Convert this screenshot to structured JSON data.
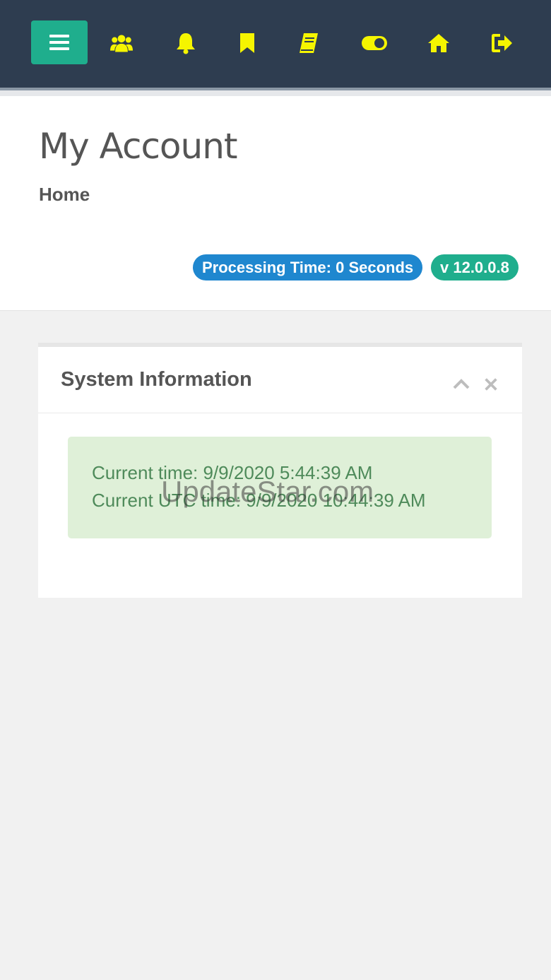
{
  "topbar": {
    "icons": [
      {
        "name": "menu-icon"
      },
      {
        "name": "users-icon"
      },
      {
        "name": "bell-icon"
      },
      {
        "name": "bookmark-icon"
      },
      {
        "name": "book-icon"
      },
      {
        "name": "toggle-icon"
      },
      {
        "name": "home-icon"
      },
      {
        "name": "sign-out-icon"
      }
    ],
    "colors": {
      "background": "#2e3d50",
      "icon": "#f5f500",
      "menu_button": "#1fae8d"
    }
  },
  "header": {
    "title": "My Account",
    "breadcrumb": "Home",
    "processing_badge": "Processing Time: 0 Seconds",
    "version_badge": "v 12.0.0.8"
  },
  "portlet": {
    "title": "System Information",
    "current_time": "Current time: 9/9/2020 5:44:39 AM",
    "current_utc_time": "Current UTC time: 9/9/2020 10:44:39 AM"
  },
  "watermark": "UpdateStar.com"
}
